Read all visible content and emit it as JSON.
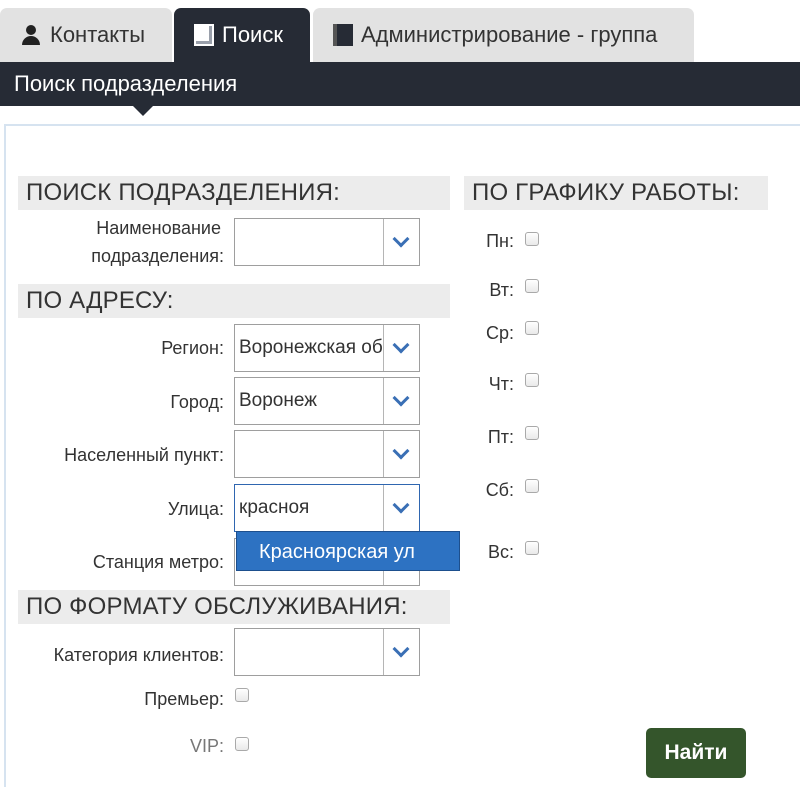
{
  "tabs": [
    {
      "label": "Контакты",
      "icon": "user-icon"
    },
    {
      "label": "Поиск",
      "icon": "document-icon",
      "active": true
    },
    {
      "label": "Администрирование - группа",
      "icon": "document-dark-icon"
    }
  ],
  "header": {
    "title": "Поиск подразделения"
  },
  "sections": {
    "search": "ПОИСК ПОДРАЗДЕЛЕНИЯ:",
    "address": "ПО АДРЕСУ:",
    "format": "ПО ФОРМАТУ ОБСЛУЖИВАНИЯ:",
    "schedule": "ПО ГРАФИКУ РАБОТЫ:"
  },
  "fields": {
    "unit_name": {
      "label_line1": "Наименование",
      "label_line2": "подразделения:",
      "value": ""
    },
    "region": {
      "label": "Регион:",
      "value": "Воронежская об"
    },
    "city": {
      "label": "Город:",
      "value": "Воронеж"
    },
    "locality": {
      "label": "Населенный пункт:",
      "value": ""
    },
    "street": {
      "label": "Улица:",
      "value": "красноя"
    },
    "metro": {
      "label": "Станция метро:",
      "value": ""
    },
    "client_category": {
      "label": "Категория клиентов:",
      "value": ""
    }
  },
  "street_suggestion": "Красноярская ул",
  "options": {
    "premier": "Премьер:",
    "vip": "VIP:"
  },
  "schedule_days": [
    "Пн:",
    "Вт:",
    "Ср:",
    "Чт:",
    "Пт:",
    "Сб:",
    "Вс:"
  ],
  "buttons": {
    "find": "Найти"
  },
  "colors": {
    "header_bg": "#262b35",
    "accent": "#2d72c2",
    "find_button": "#34552b"
  }
}
